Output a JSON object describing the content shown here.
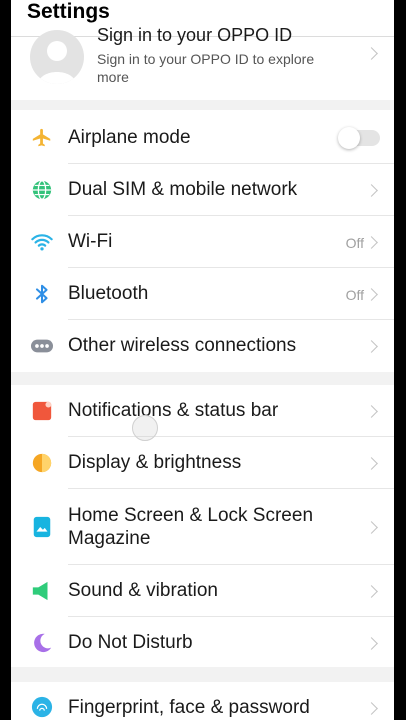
{
  "header": {
    "title": "Settings"
  },
  "account": {
    "title": "Sign in to your OPPO ID",
    "subtitle_line1": "Sign in to your OPPO ID to explore",
    "subtitle_line2": "more"
  },
  "connectivity": [
    {
      "label": "Airplane mode",
      "icon": "airplane-icon",
      "toggle_on": false
    },
    {
      "label": "Dual SIM & mobile network",
      "icon": "globe-icon"
    },
    {
      "label": "Wi-Fi",
      "icon": "wifi-icon",
      "status": "Off"
    },
    {
      "label": "Bluetooth",
      "icon": "bluetooth-icon",
      "status": "Off"
    },
    {
      "label": "Other wireless connections",
      "icon": "more-icon"
    }
  ],
  "personalization": [
    {
      "label": "Notifications & status bar",
      "icon": "notification-icon"
    },
    {
      "label": "Display & brightness",
      "icon": "brightness-icon"
    },
    {
      "label_line1": "Home Screen & Lock Screen",
      "label_line2": "Magazine",
      "icon": "picture-icon"
    },
    {
      "label": "Sound & vibration",
      "icon": "speaker-icon"
    },
    {
      "label": "Do Not Disturb",
      "icon": "moon-icon"
    }
  ],
  "security": [
    {
      "label": "Fingerprint, face & password",
      "icon": "fingerprint-icon"
    }
  ],
  "colors": {
    "airplane": "#f4b433",
    "globe": "#33c27a",
    "wifi": "#2bb3e6",
    "bluetooth": "#2f8fe6",
    "notification": "#f0573c",
    "brightness": "#f5a623",
    "picture": "#18b4e0",
    "speaker": "#2fcc7a",
    "moon": "#a870e8"
  }
}
